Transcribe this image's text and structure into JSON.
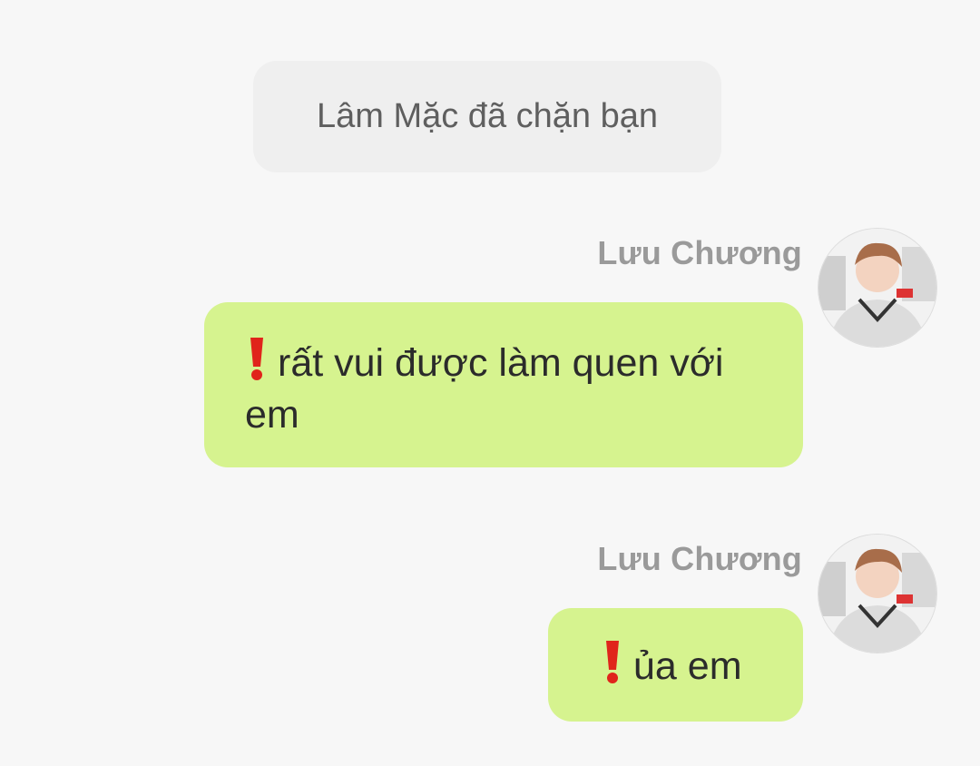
{
  "system_notice": "Lâm Mặc đã chặn bạn",
  "messages": [
    {
      "sender": "Lưu Chương",
      "text": "rất vui được làm quen với em",
      "status_icon": "red-exclamation-icon",
      "avatar": "user-avatar-photo"
    },
    {
      "sender": "Lưu Chương",
      "text": "ủa em",
      "status_icon": "red-exclamation-icon",
      "avatar": "user-avatar-photo"
    }
  ],
  "colors": {
    "background": "#f7f7f7",
    "bubble": "#d6f38f",
    "notice_bg": "#efefef",
    "alert": "#e0241b"
  }
}
